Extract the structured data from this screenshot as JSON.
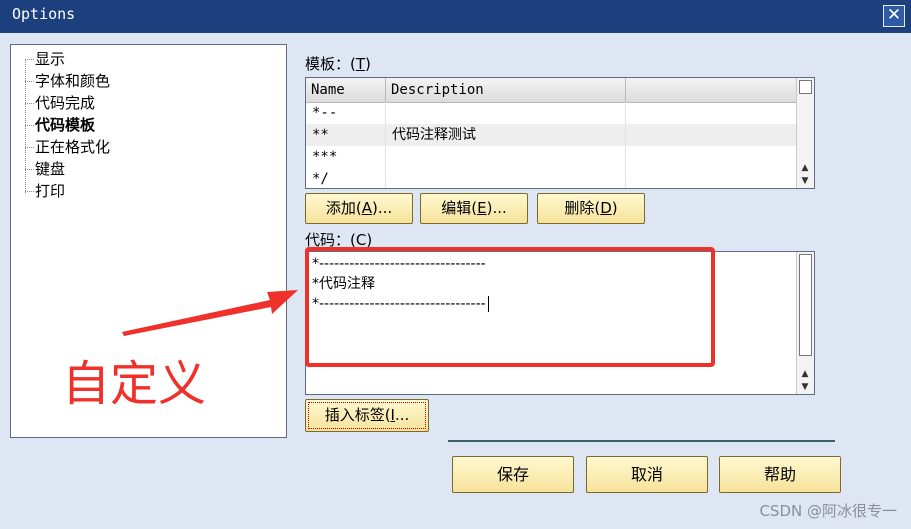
{
  "window": {
    "title": "Options",
    "close_symbol": "✕"
  },
  "tree": {
    "items": [
      {
        "label": "显示",
        "selected": false
      },
      {
        "label": "字体和颜色",
        "selected": false
      },
      {
        "label": "代码完成",
        "selected": false
      },
      {
        "label": "代码模板",
        "selected": true
      },
      {
        "label": "正在格式化",
        "selected": false
      },
      {
        "label": "键盘",
        "selected": false
      },
      {
        "label": "打印",
        "selected": false
      }
    ]
  },
  "templates": {
    "label_prefix": "模板：(",
    "label_key": "T",
    "label_suffix": ")",
    "columns": [
      "Name",
      "Description"
    ],
    "rows": [
      {
        "name": "*--",
        "description": ""
      },
      {
        "name": "**",
        "description": "代码注释测试"
      },
      {
        "name": "***",
        "description": ""
      },
      {
        "name": "*/",
        "description": ""
      }
    ]
  },
  "template_buttons": {
    "add": {
      "prefix": "添加(",
      "key": "A",
      "suffix": ")..."
    },
    "edit": {
      "prefix": "编辑(",
      "key": "E",
      "suffix": ")..."
    },
    "delete": {
      "prefix": "删除(",
      "key": "D",
      "suffix": ")"
    }
  },
  "code": {
    "label": "代码：(C)",
    "lines": [
      "*---------------------------------",
      "*代码注释",
      "*---------------------------------"
    ]
  },
  "insert_button": {
    "prefix": "插入标签(",
    "key": "I",
    "suffix": "..."
  },
  "dialog_buttons": {
    "save": "保存",
    "cancel": "取消",
    "help": "帮助"
  },
  "annotation": {
    "text": "自定义",
    "color": "#f0302a"
  },
  "watermark": "CSDN @阿冰很专一",
  "colors": {
    "titlebar": "#1c3f7d",
    "dialog_bg": "#dde6f2",
    "button": "#f6e29b"
  }
}
